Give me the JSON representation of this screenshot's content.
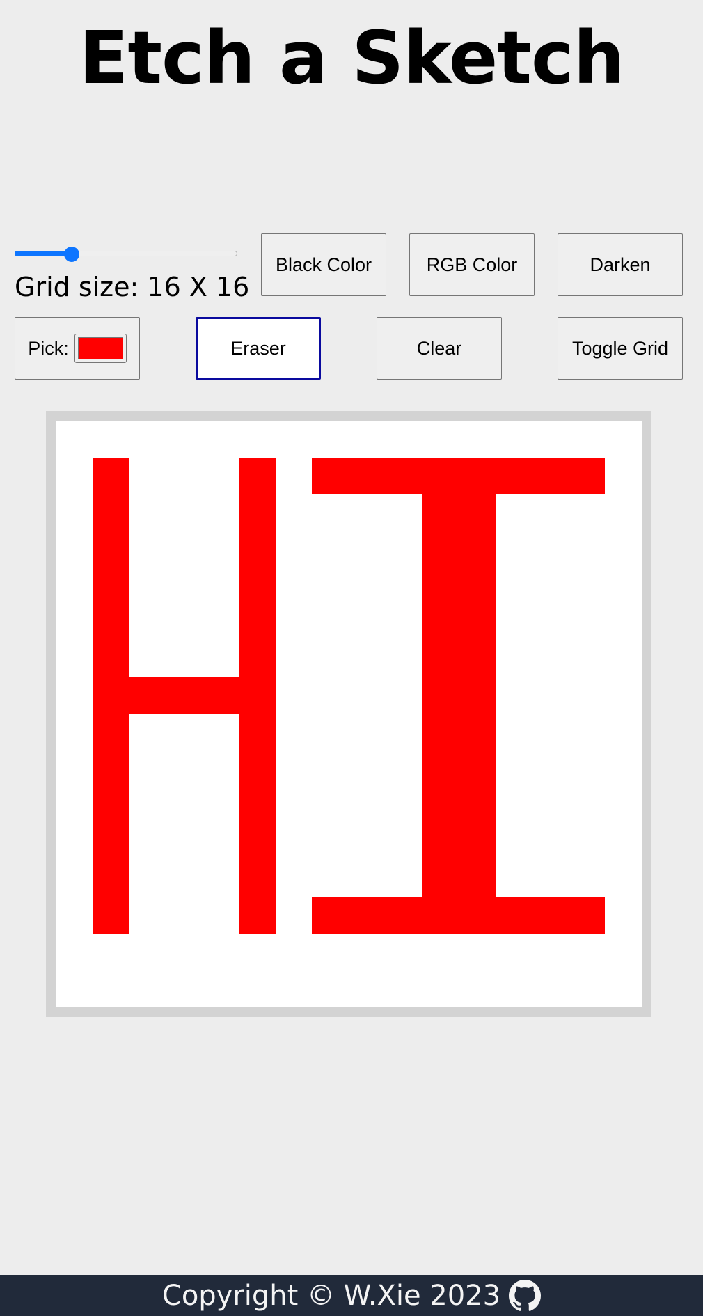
{
  "header": {
    "title": "Etch a Sketch"
  },
  "controls": {
    "slider": {
      "min": 1,
      "max": 64,
      "value": 16
    },
    "grid_size_text": "Grid size: 16 X 16",
    "black_color_label": "Black Color",
    "rgb_color_label": "RGB Color",
    "darken_label": "Darken",
    "pick_label": "Pick:",
    "pick_color": "#ff0000",
    "eraser_label": "Eraser",
    "clear_label": "Clear",
    "toggle_grid_label": "Toggle Grid",
    "active_tool": "eraser"
  },
  "board": {
    "size": 16,
    "background": "#ffffff",
    "paint_color": "#ff0000",
    "rows": [
      "0000000000000000",
      "0100010111111110",
      "0100010000110000",
      "0100010000110000",
      "0100010000110000",
      "0100010000110000",
      "0100010000110000",
      "0111110000110000",
      "0100010000110000",
      "0100010000110000",
      "0100010000110000",
      "0100010000110000",
      "0100010000110000",
      "0100010111111110",
      "0000000000000000",
      "0000000000000000"
    ]
  },
  "footer": {
    "text": "Copyright © W.Xie 2023",
    "icon": "github-icon"
  }
}
